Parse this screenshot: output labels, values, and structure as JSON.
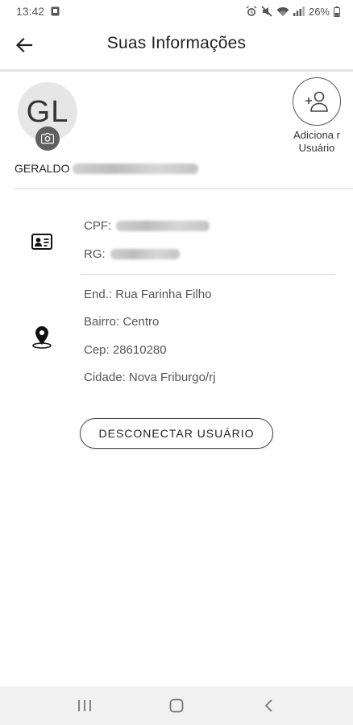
{
  "status_bar": {
    "time": "13:42",
    "battery": "26%",
    "icons": [
      "sim-icon",
      "alarm-icon",
      "mute-icon",
      "wifi-icon",
      "signal-icon",
      "battery-icon"
    ]
  },
  "header": {
    "title": "Suas Informações",
    "back_icon": "arrow-left-icon"
  },
  "profile": {
    "initials": "GL",
    "camera_icon": "camera-icon",
    "name_visible": "GERALDO",
    "name_hidden_note": "",
    "add_user_label": "Adiciona r Usuário",
    "add_user_icon": "person-add-icon"
  },
  "documents": {
    "icon": "id-card-icon",
    "cpf_label": "CPF:",
    "rg_label": "RG:"
  },
  "address": {
    "icon": "location-pin-icon",
    "street": "End.: Rua Farinha Filho",
    "district": "Bairro: Centro",
    "zip": "Cep: 28610280",
    "city": "Cidade: Nova Friburgo/rj"
  },
  "actions": {
    "logout_label": "DESCONECTAR USUÁRIO"
  },
  "nav_bar": {
    "recents_icon": "recents-icon",
    "home_icon": "home-icon",
    "back_icon": "nav-back-icon"
  },
  "colors": {
    "divider": "#e4e4e4",
    "avatar_bg": "#e6e6e6",
    "badge_bg": "#5f5f5f",
    "nav_bg": "#f1f1f1"
  }
}
